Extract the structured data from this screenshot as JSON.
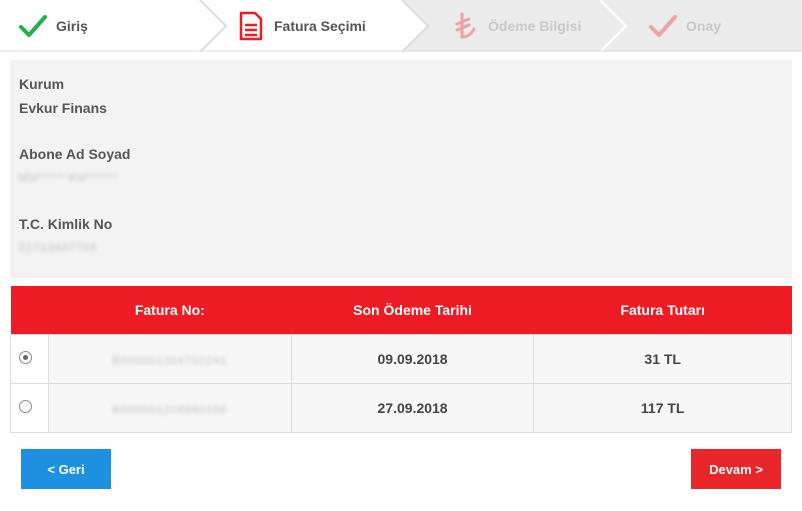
{
  "steps": [
    {
      "label": "Giriş",
      "state": "done",
      "icon": "check-icon"
    },
    {
      "label": "Fatura Seçimi",
      "state": "active",
      "icon": "document-icon"
    },
    {
      "label": "Ödeme Bilgisi",
      "state": "pending",
      "icon": "lira-icon"
    },
    {
      "label": "Onay",
      "state": "pending",
      "icon": "check-icon"
    }
  ],
  "info": {
    "kurum_label": "Kurum",
    "kurum_value": "Evkur Finans",
    "abone_label": "Abone Ad Soyad",
    "abone_value": "MU***** KU******",
    "tc_label": "T.C. Kimlik No",
    "tc_value": "21713447716"
  },
  "table": {
    "headers": [
      "",
      "Fatura No:",
      "Son Ödeme Tarihi",
      "Fatura Tutarı"
    ],
    "rows": [
      {
        "selected": true,
        "fatura_no": "B000001204702241",
        "tarih": "09.09.2018",
        "tutar": "31 TL"
      },
      {
        "selected": false,
        "fatura_no": "B000001204660156",
        "tarih": "27.09.2018",
        "tutar": "117 TL"
      }
    ]
  },
  "buttons": {
    "back": "< Geri",
    "next": "Devam >"
  },
  "colors": {
    "accent_red": "#ed1c24",
    "blue": "#1e90e0",
    "green_check": "#22b14c",
    "pending": "#f2a0a8"
  }
}
